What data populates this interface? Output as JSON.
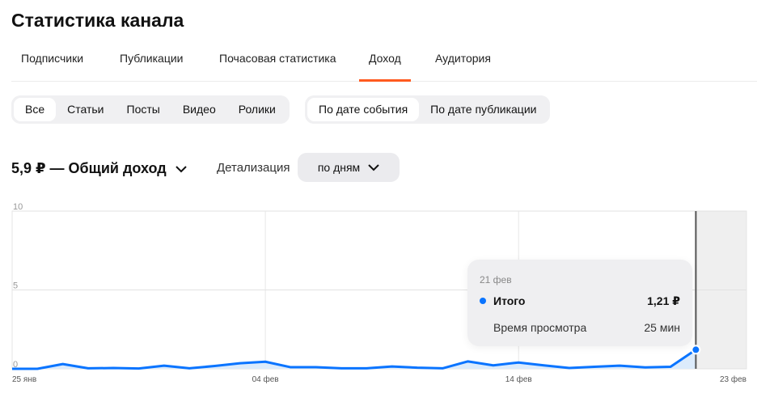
{
  "title": "Статистика канала",
  "tabs": [
    "Подписчики",
    "Публикации",
    "Почасовая статистика",
    "Доход",
    "Аудитория"
  ],
  "active_tab": 3,
  "content_filter": [
    "Все",
    "Статьи",
    "Посты",
    "Видео",
    "Ролики"
  ],
  "date_filter": [
    "По дате события",
    "По дате публикации"
  ],
  "total": "5,9 ₽ — Общий доход",
  "detail_label": "Детализация",
  "detail_value": "по дням",
  "tooltip": {
    "date": "21 фев",
    "total_label": "Итого",
    "total_value": "1,21 ₽",
    "watch_label": "Время просмотра",
    "watch_value": "25 мин"
  },
  "colors": {
    "accent": "#ff5a1f",
    "line": "#0a74ff"
  },
  "chart_data": {
    "type": "area",
    "ylim": [
      0,
      10
    ],
    "y_ticks": [
      "0",
      "5",
      "10"
    ],
    "x_ticks": [
      {
        "day": 0,
        "label": "25 янв"
      },
      {
        "day": 10,
        "label": "04 фев"
      },
      {
        "day": 20,
        "label": "14 фев"
      },
      {
        "day": 29,
        "label": "23 фев"
      }
    ],
    "x_days_total": 29,
    "series": [
      {
        "name": "Итого",
        "values": [
          0,
          0,
          0.3,
          0.03,
          0.05,
          0.02,
          0.2,
          0.03,
          0.18,
          0.35,
          0.45,
          0.1,
          0.1,
          0.03,
          0.03,
          0.15,
          0.07,
          0.03,
          0.47,
          0.22,
          0.4,
          0.22,
          0.05,
          0.13,
          0.2,
          0.09,
          0.13,
          1.21
        ]
      }
    ],
    "highlight_index": 27
  }
}
